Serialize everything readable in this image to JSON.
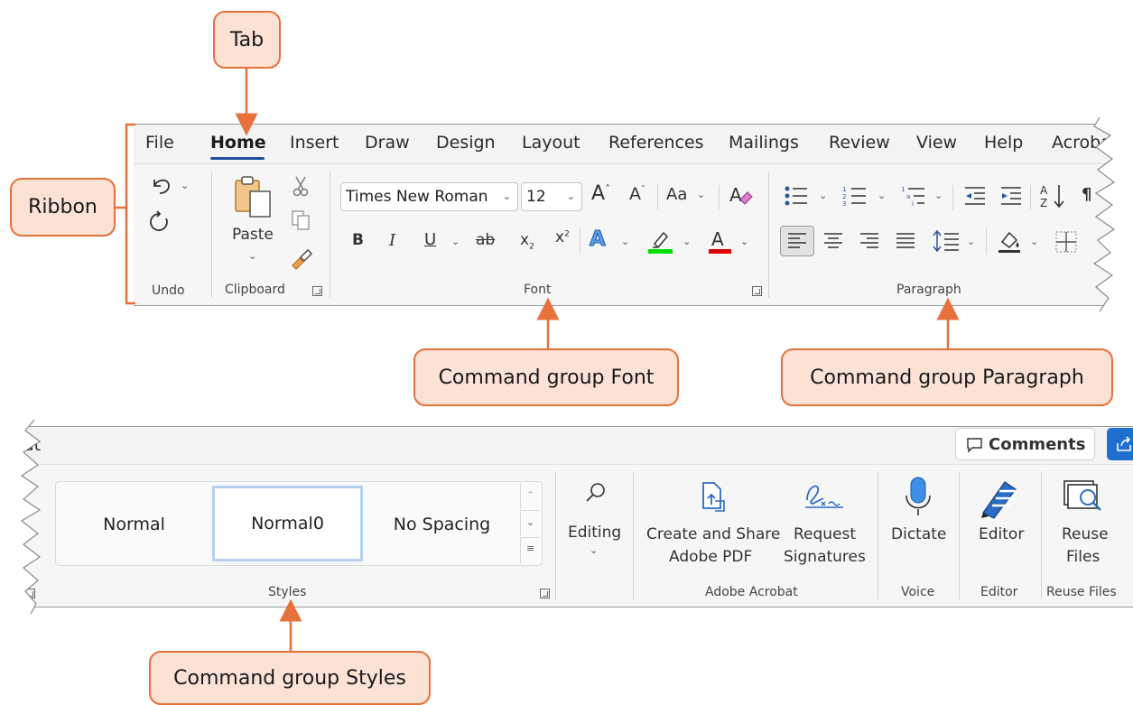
{
  "callouts": {
    "tab": "Tab",
    "ribbon": "Ribbon",
    "font": "Command group Font",
    "paragraph": "Command group Paragraph",
    "styles": "Command group Styles"
  },
  "tabs": [
    "File",
    "Home",
    "Insert",
    "Draw",
    "Design",
    "Layout",
    "References",
    "Mailings",
    "Review",
    "View",
    "Help",
    "Acrobat"
  ],
  "clipboard": {
    "paste_label": "Paste"
  },
  "font": {
    "name": "Times New Roman",
    "size": "12",
    "change_case": "Aa"
  },
  "groups": {
    "undo": "Undo",
    "clipboard": "Clipboard",
    "font": "Font",
    "paragraph": "Paragraph",
    "styles": "Styles",
    "adobe": "Adobe Acrobat",
    "voice": "Voice",
    "editor": "Editor",
    "reuse": "Reuse Files"
  },
  "top_right": {
    "comments_label": "Comments"
  },
  "styles": {
    "items": [
      "Normal",
      "Normal0",
      "No Spacing"
    ],
    "selected": "Normal0"
  },
  "editing": {
    "label": "Editing"
  },
  "adobe": {
    "create_pdf_line1": "Create and Share",
    "create_pdf_line2": "Adobe PDF",
    "request_sig_line1": "Request",
    "request_sig_line2": "Signatures"
  },
  "voice": {
    "dictate": "Dictate"
  },
  "editor": {
    "label": "Editor"
  },
  "reuse": {
    "line1": "Reuse",
    "line2": "Files"
  },
  "colors": {
    "accent_callout": "#e8703a",
    "callout_fill": "#fbe2d5",
    "highlight": "#00e000",
    "font_color": "#e00000",
    "share_blue": "#1e6fd0"
  }
}
